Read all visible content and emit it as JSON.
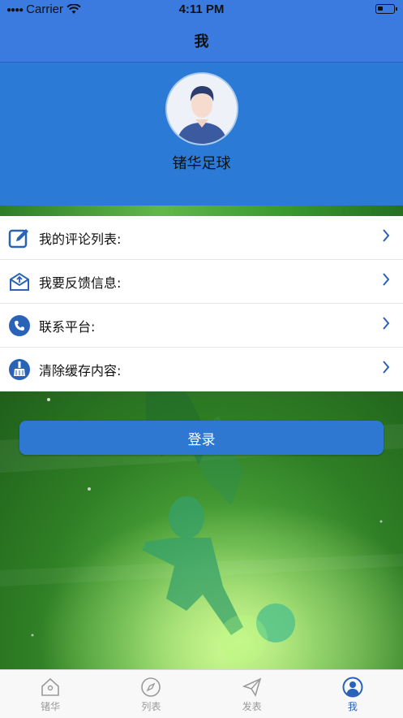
{
  "status_bar": {
    "carrier": "Carrier",
    "time": "4:11 PM"
  },
  "navbar": {
    "title": "我"
  },
  "profile": {
    "username": "锗华足球",
    "avatar_icon": "person-avatar-icon"
  },
  "menu": {
    "items": [
      {
        "label": "我的评论列表:",
        "icon": "edit-icon"
      },
      {
        "label": "我要反馈信息:",
        "icon": "feedback-envelope-icon"
      },
      {
        "label": "联系平台:",
        "icon": "phone-icon"
      },
      {
        "label": "清除缓存内容:",
        "icon": "broom-icon"
      }
    ]
  },
  "login_button": {
    "label": "登录"
  },
  "tabbar": {
    "tabs": [
      {
        "label": "锗华",
        "icon": "home-icon"
      },
      {
        "label": "列表",
        "icon": "compass-icon"
      },
      {
        "label": "发表",
        "icon": "send-icon"
      },
      {
        "label": "我",
        "icon": "user-icon",
        "active": true
      }
    ]
  },
  "colors": {
    "accent": "#2e78d2",
    "header": "#2a7ad6",
    "navbar": "#3b7be0",
    "active_tab": "#2a62b8"
  }
}
